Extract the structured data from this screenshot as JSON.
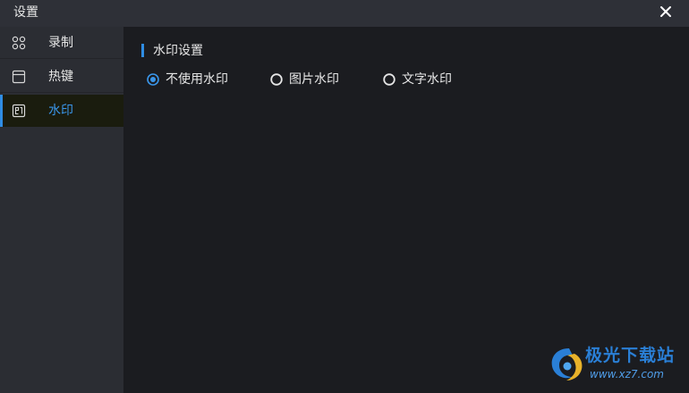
{
  "window": {
    "title": "设置",
    "close_icon": "close-icon"
  },
  "sidebar": {
    "items": [
      {
        "label": "录制",
        "icon": "grid-icon",
        "active": false
      },
      {
        "label": "热键",
        "icon": "window-icon",
        "active": false
      },
      {
        "label": "水印",
        "icon": "watermark-icon",
        "active": true
      }
    ]
  },
  "content": {
    "section_title": "水印设置",
    "options": [
      {
        "label": "不使用水印",
        "selected": true
      },
      {
        "label": "图片水印",
        "selected": false
      },
      {
        "label": "文字水印",
        "selected": false
      }
    ]
  },
  "watermark": {
    "brand": "极光下载站",
    "url": "www.xz7.com"
  },
  "colors": {
    "accent": "#2f8de4",
    "titlebar_bg": "#2e3037",
    "sidebar_bg": "#2b2d33",
    "content_bg": "#1b1c20",
    "active_item_bg": "#1a1c0e",
    "text": "#e6e6e6"
  }
}
